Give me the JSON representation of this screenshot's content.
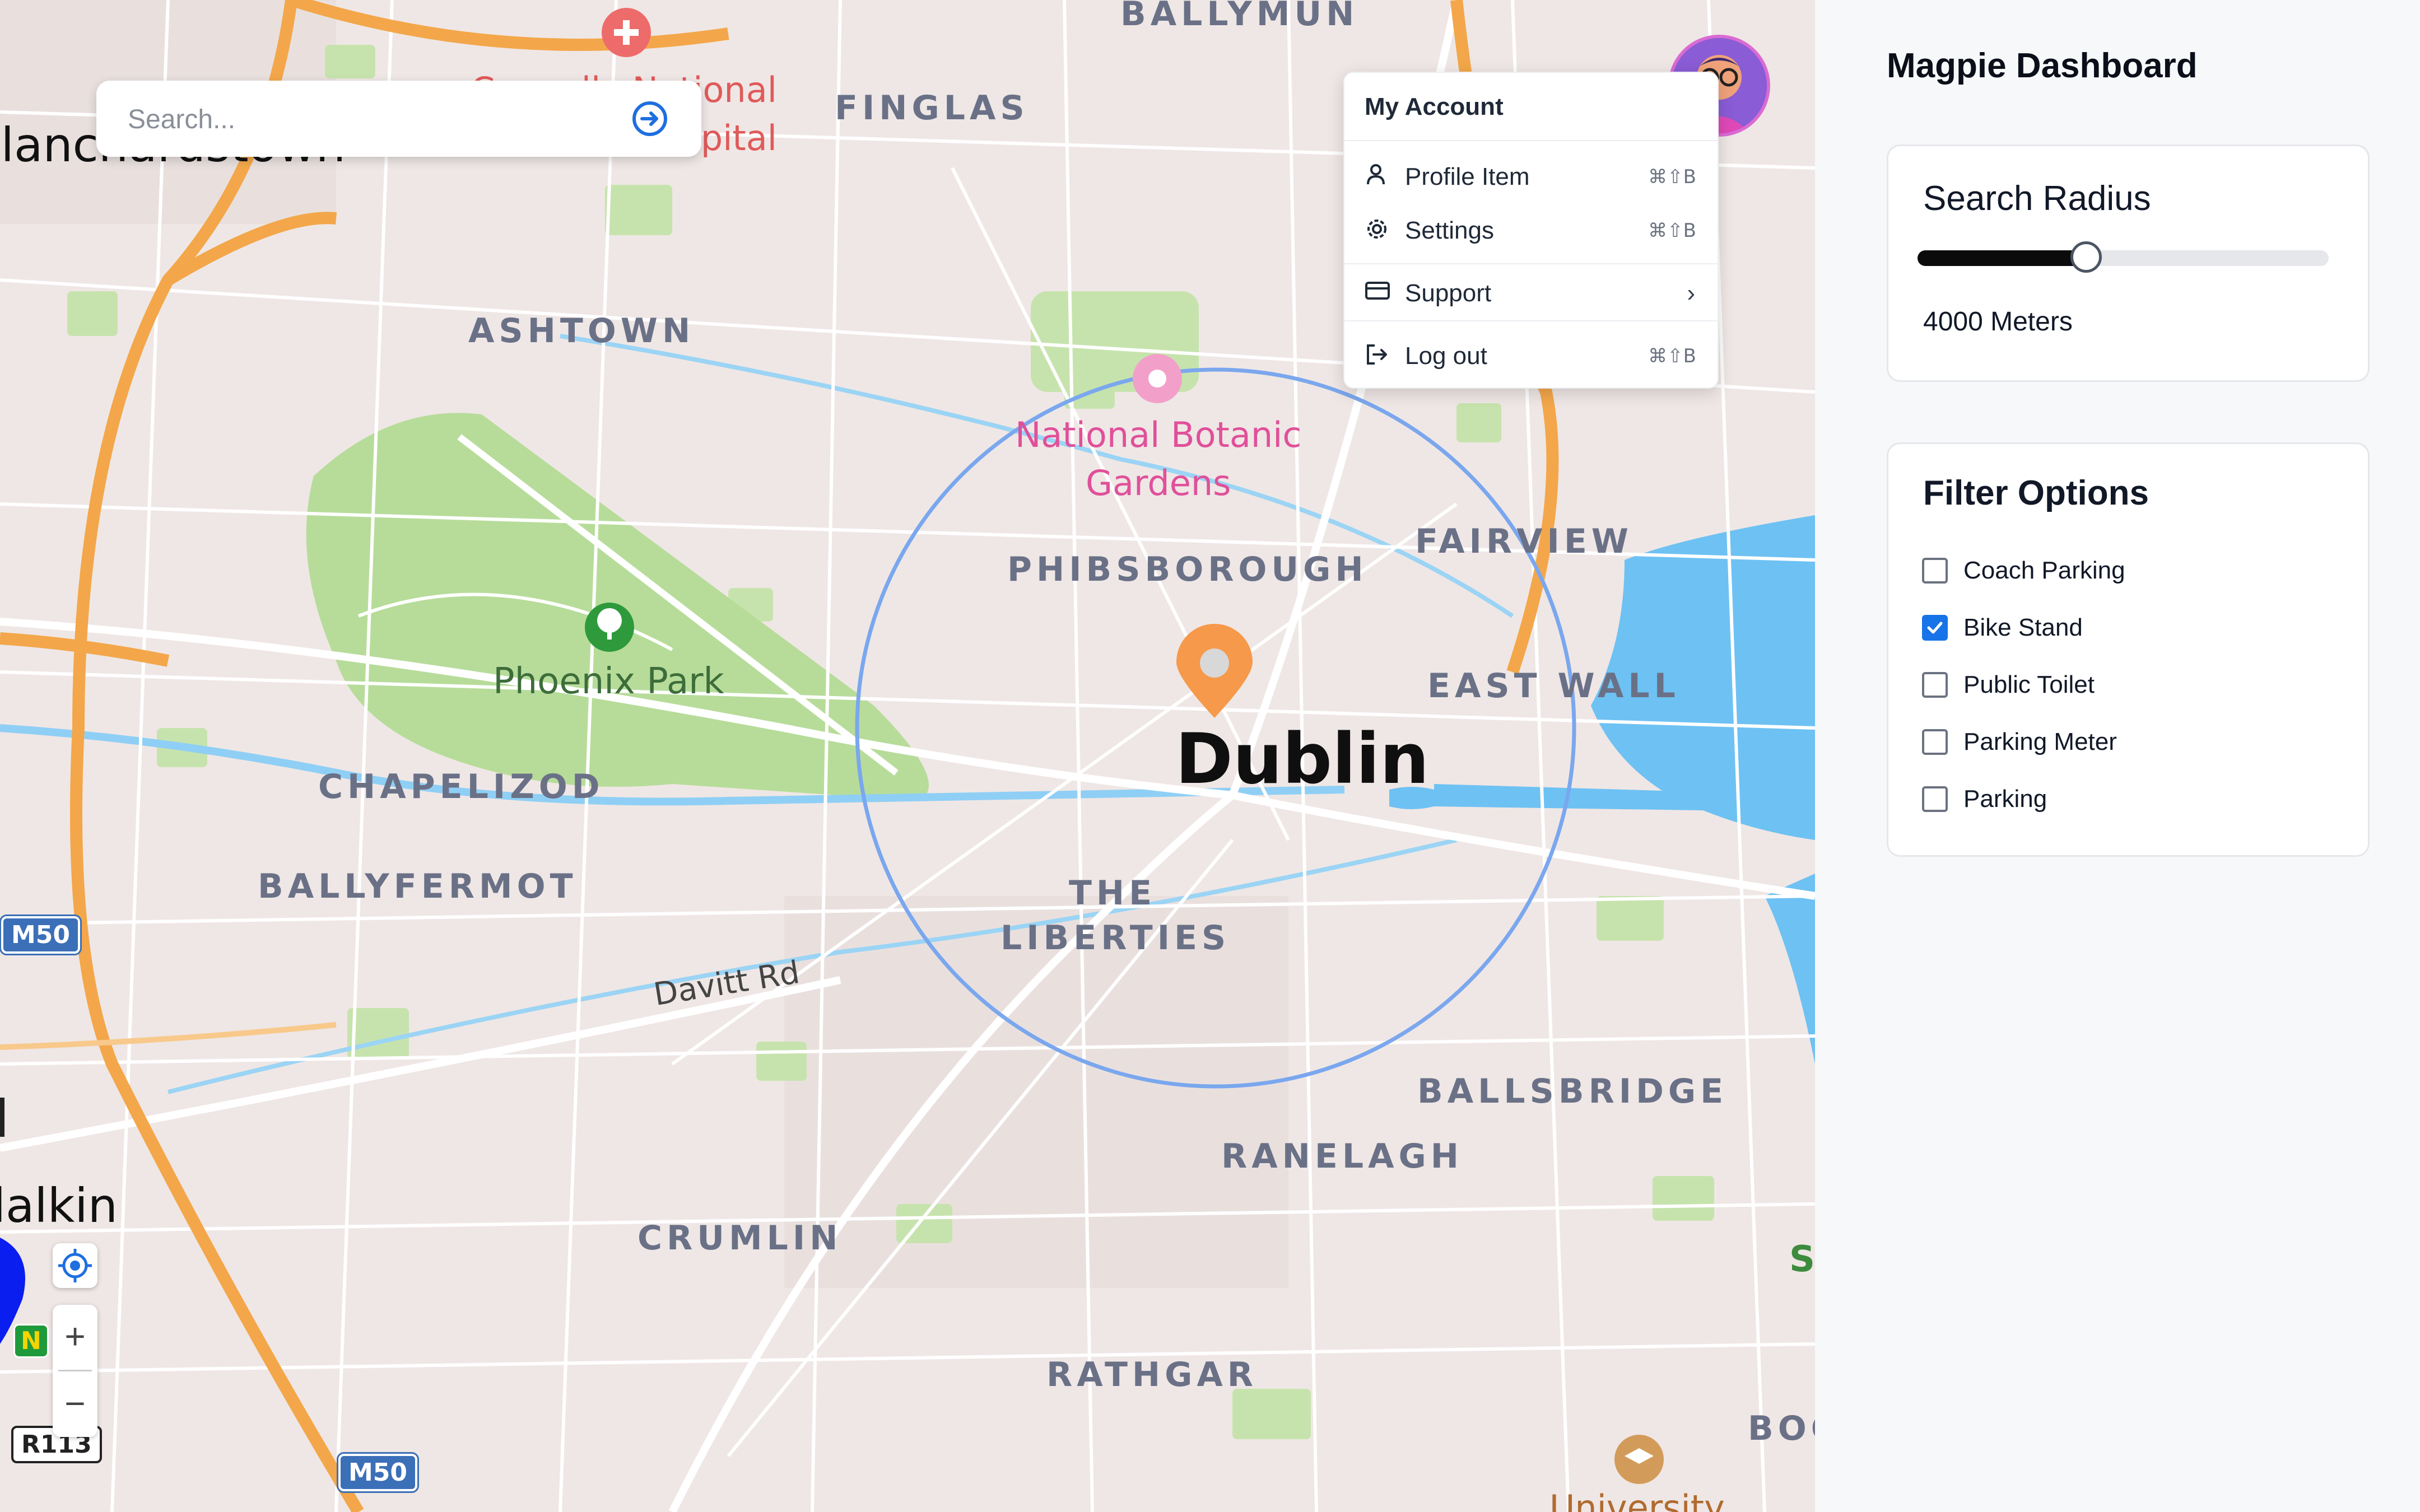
{
  "search": {
    "placeholder": "Search..."
  },
  "account_menu": {
    "header": "My Account",
    "items": [
      {
        "label": "Profile Item",
        "shortcut": "⌘⇧B",
        "icon": "person-icon"
      },
      {
        "label": "Settings",
        "shortcut": "⌘⇧B",
        "icon": "gear-icon"
      },
      {
        "label": "Support",
        "shortcut": "",
        "icon": "credit-card-icon",
        "submenu": true
      },
      {
        "label": "Log out",
        "shortcut": "⌘⇧B",
        "icon": "logout-icon"
      }
    ],
    "submenu_glyph": "›"
  },
  "map": {
    "city": "Dublin",
    "districts": [
      "BALLYMUN",
      "FINGLAS",
      "ASHTOWN",
      "PHIBSBOROUGH",
      "FAIRVIEW",
      "EAST WALL",
      "CHAPELIZOD",
      "BALLYFERMOT",
      "THE",
      "LIBERTIES",
      "BALLSBRIDGE",
      "RANELAGH",
      "CRUMLIN",
      "RATHGAR",
      "BOO"
    ],
    "places": {
      "phoenix_park": "Phoenix Park",
      "botanic_line1": "National Botanic",
      "botanic_line2": "Gardens",
      "hospital_line1": "Connolly National",
      "hospital_line2": "Hospital",
      "blanchardstown": "Blanchardstown",
      "clondalkin": "Clondalkin",
      "university": "University",
      "s_label": "S"
    },
    "roads": {
      "davitt": "Davitt Rd"
    },
    "shields": {
      "m50_top": "M50",
      "m50_bottom": "M50",
      "r113": "R113",
      "n": "N"
    },
    "zoom_in": "+",
    "zoom_out": "−",
    "colors": {
      "radius_circle": "#7aa7ee",
      "pin": "#f6994a",
      "park": "#b7dc9a",
      "water": "#6ec1f3",
      "motorway": "#f3a74a"
    },
    "selected_pin_icon": "map-pin-icon"
  },
  "panel": {
    "title": "Magpie Dashboard",
    "radius_card": {
      "title": "Search Radius",
      "value_label": "4000 Meters",
      "slider_fraction": 0.41
    },
    "filters": {
      "title": "Filter Options",
      "options": [
        {
          "label": "Coach Parking",
          "checked": false
        },
        {
          "label": "Bike Stand",
          "checked": true
        },
        {
          "label": "Public Toilet",
          "checked": false
        },
        {
          "label": "Parking Meter",
          "checked": false
        },
        {
          "label": "Parking",
          "checked": false
        }
      ]
    }
  }
}
